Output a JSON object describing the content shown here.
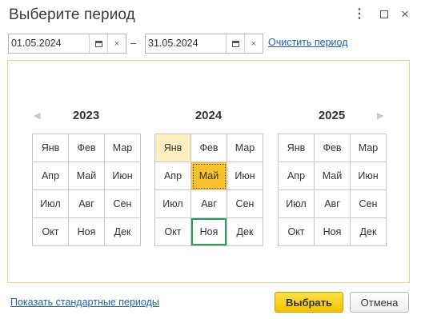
{
  "window": {
    "title": "Выберите период",
    "more_glyph": "⋮",
    "close_glyph": "×"
  },
  "period": {
    "start": "01.05.2024",
    "end": "31.05.2024",
    "separator": "–",
    "clear_glyph": "×",
    "clear_link": "Очистить период"
  },
  "nav": {
    "prev_glyph": "◀",
    "next_glyph": "▶"
  },
  "years": [
    {
      "label": "2023",
      "months": [
        "Янв",
        "Фев",
        "Мар",
        "Апр",
        "Май",
        "Июн",
        "Июл",
        "Авг",
        "Сен",
        "Окт",
        "Ноя",
        "Дек"
      ]
    },
    {
      "label": "2024",
      "months": [
        "Янв",
        "Фев",
        "Мар",
        "Апр",
        "Май",
        "Июн",
        "Июл",
        "Авг",
        "Сен",
        "Окт",
        "Ноя",
        "Дек"
      ]
    },
    {
      "label": "2025",
      "months": [
        "Янв",
        "Фев",
        "Мар",
        "Апр",
        "Май",
        "Июн",
        "Июл",
        "Авг",
        "Сен",
        "Окт",
        "Ноя",
        "Дек"
      ]
    }
  ],
  "selection": {
    "selected_year": "2024",
    "selected_month": "Май",
    "highlight_year": "2024",
    "highlight_month": "Янв",
    "current_year": "2024",
    "current_month": "Ноя"
  },
  "footer": {
    "standard_periods_link": "Показать стандартные периоды",
    "ok_button": "Выбрать",
    "cancel_button": "Отмена"
  },
  "colors": {
    "accent": "#f5c12e",
    "range": "#fdefc0",
    "current_border": "#2e9a57",
    "link": "#1f5fb5",
    "panel_border": "#e8d58a"
  }
}
